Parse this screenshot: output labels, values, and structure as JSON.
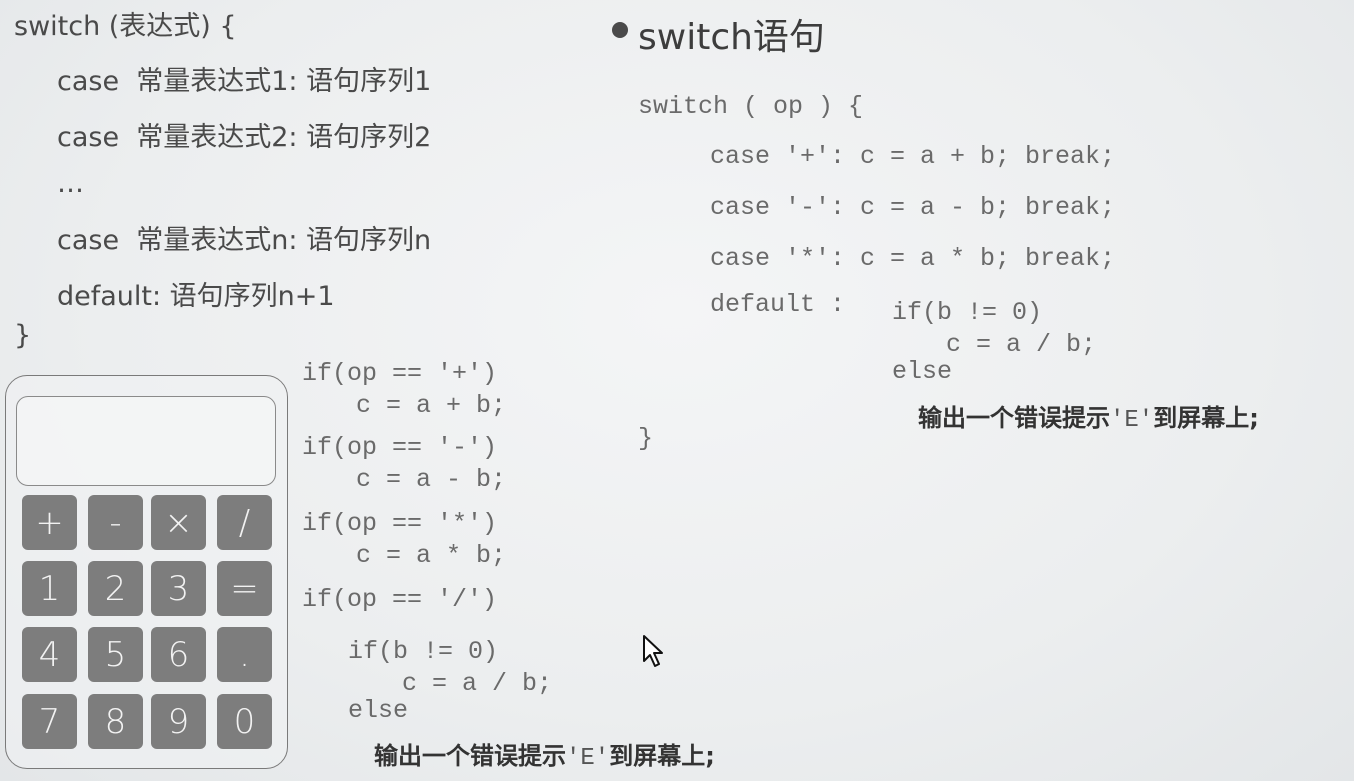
{
  "syntax": {
    "line1": "switch (表达式) {",
    "line2": "case  常量表达式1: 语句序列1",
    "line3": "case  常量表达式2: 语句序列2",
    "line4": "…",
    "line5": "case  常量表达式n: 语句序列n",
    "line6": "default: 语句序列n+1",
    "line7": "}"
  },
  "title": "switch语句",
  "if_code": {
    "l1": "if(op == '+')",
    "l2": "c = a + b;",
    "l3": "if(op == '-')",
    "l4": "c = a - b;",
    "l5": "if(op == '*')",
    "l6": "c = a * b;",
    "l7": "if(op == '/')",
    "l8": "if(b != 0)",
    "l9": "c = a / b;",
    "l10": "else",
    "msg_a": "输出一个错误提示",
    "msg_b": "'E'",
    "msg_c": "到屏幕上;"
  },
  "switch_code": {
    "l1": "switch ( op ) {",
    "l2": "case '+': c = a + b; break;",
    "l3": "case '-': c = a - b; break;",
    "l4": "case '*': c = a * b; break;",
    "l5a": "default :",
    "l5b": "if(b != 0)",
    "l6": "c = a / b;",
    "l7": "else",
    "msg_a": "输出一个错误提示",
    "msg_b": "'E'",
    "msg_c": "到屏幕上;",
    "l9": "}"
  },
  "calculator": {
    "keys": [
      "+",
      "-",
      "×",
      "/",
      "1",
      "2",
      "3",
      "=",
      "4",
      "5",
      "6",
      ".",
      "7",
      "8",
      "9",
      "0"
    ]
  }
}
